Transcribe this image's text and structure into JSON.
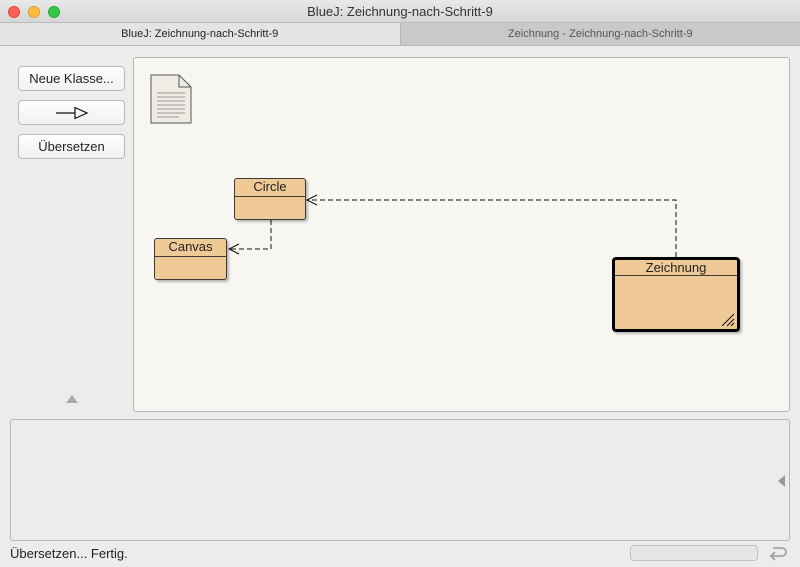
{
  "window": {
    "title": "BlueJ:  Zeichnung-nach-Schritt-9"
  },
  "tabs": [
    {
      "label": "BlueJ:  Zeichnung-nach-Schritt-9",
      "active": true
    },
    {
      "label": "Zeichnung - Zeichnung-nach-Schritt-9",
      "active": false
    }
  ],
  "sidebar": {
    "new_class_label": "Neue Klasse...",
    "arrow_button_icon": "uses-arrow-icon",
    "compile_label": "Übersetzen",
    "collapse_icon": "triangle-up-icon"
  },
  "diagram": {
    "readme_icon": "document-icon",
    "classes": [
      {
        "name": "Circle",
        "selected": false
      },
      {
        "name": "Canvas",
        "selected": false
      },
      {
        "name": "Zeichnung",
        "selected": true
      }
    ],
    "dependencies": [
      {
        "from": "Zeichnung",
        "to": "Circle",
        "style": "dashed"
      },
      {
        "from": "Circle",
        "to": "Canvas",
        "style": "dashed"
      }
    ],
    "colors": {
      "class_fill": "#f0ca96",
      "canvas_bg": "#f7f6f1",
      "border": "#3b3b3b"
    }
  },
  "terminal": {
    "expand_icon": "triangle-left-icon"
  },
  "status": {
    "text": "Übersetzen... Fertig.",
    "reset_icon": "return-arrow-icon"
  }
}
